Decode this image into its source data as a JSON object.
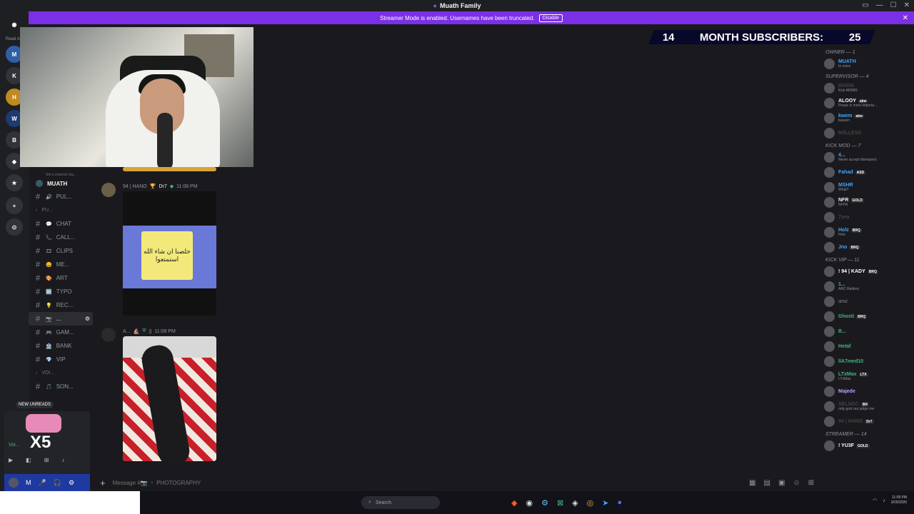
{
  "window": {
    "title": "Muath Family",
    "controls": [
      "▭",
      "—",
      "☐",
      "✕"
    ]
  },
  "banner": {
    "text": "Streamer Mode is enabled. Usernames have been truncated.",
    "button": "Disable",
    "close": "✕"
  },
  "left_rail": {
    "read_label": "Read A"
  },
  "sub_overlay": {
    "left_number": "14",
    "label": "MONTH SUBSCRIBERS:",
    "right_number": "25"
  },
  "server": {
    "name": "MUATH",
    "status_text": "Set a channel sta...",
    "channels": [
      {
        "icon": "🔊",
        "label": "PUL..."
      },
      {
        "icon": "",
        "label": "PU...",
        "category": true
      },
      {
        "icon": "💬",
        "label": "CHAT"
      },
      {
        "icon": "📞",
        "label": "CALL..."
      },
      {
        "icon": "🎞",
        "label": "CLIPS"
      },
      {
        "icon": "😄",
        "label": "ME..."
      },
      {
        "icon": "🎨",
        "label": "ART"
      },
      {
        "icon": "🔤",
        "label": "TYPO"
      },
      {
        "icon": "💡",
        "label": "REC..."
      },
      {
        "icon": "📷",
        "label": "...",
        "selected": true
      },
      {
        "icon": "🎮",
        "label": "GAM..."
      },
      {
        "icon": "🏦",
        "label": "BANK"
      },
      {
        "icon": "💎",
        "label": "VIP"
      },
      {
        "icon": "",
        "label": "VOI...",
        "category": true
      },
      {
        "icon": "🎵",
        "label": "SON..."
      }
    ],
    "new_unreads": "NEW UNREADS"
  },
  "messages": [
    {
      "author": "94 | HANO",
      "badge": "Dr7",
      "time": "11:08 PM",
      "image_text": "خلصنا ان شاء الله استمتعوا"
    },
    {
      "author": "A...",
      "time": "11:08 PM"
    }
  ],
  "composer": {
    "placeholder": "Message #📷 ・ PHOTOGRAPHY"
  },
  "members": {
    "groups": [
      {
        "title": "OWNER — 1",
        "items": [
          {
            "name": "MUATH",
            "sub": "In voice",
            "color": "#3ea6ff"
          }
        ]
      },
      {
        "title": "SUPERVISOR — 4",
        "items": [
          {
            "name": "BHSNI",
            "sub": "Kick ARM91",
            "color": "#444"
          },
          {
            "name": "ALOOY",
            "sub": "Peace is more importa...",
            "color": "#ffffff",
            "badge": "akw"
          },
          {
            "name": "kwem",
            "sub": "kweem",
            "color": "#3ea6ff",
            "badge": "akw"
          },
          {
            "name": "M3LLESS",
            "sub": "",
            "color": "#444"
          }
        ]
      },
      {
        "title": "KICK MOD — 7",
        "items": [
          {
            "name": "4...",
            "sub": "Never accept disrespect",
            "color": "#3ea6ff"
          },
          {
            "name": "Fahad",
            "sub": "",
            "color": "#3ea6ff",
            "badge": "ASD"
          },
          {
            "name": "MSHR",
            "sub": "What?",
            "color": "#3ea6ff"
          },
          {
            "name": "NFR",
            "sub": "NFFR",
            "color": "#f2f3f5",
            "badge": "GOLD"
          },
          {
            "name": "7yea",
            "sub": "",
            "color": "#444"
          },
          {
            "name": "Holz",
            "sub": "Holz",
            "color": "#3ea6ff",
            "badge": "BRQ"
          },
          {
            "name": "Jno",
            "sub": "",
            "color": "#3ea6ff",
            "badge": "BRQ"
          }
        ]
      },
      {
        "title": "KICK VIP — 11",
        "items": [
          {
            "name": "! 94 | KADY",
            "sub": "",
            "color": "#ffffff",
            "badge": "BRQ"
          },
          {
            "name": "1...",
            "sub": "ARC Raiders",
            "color": "#43b581"
          },
          {
            "name": "",
            "sub": "9DNZ",
            "color": "#43b581"
          },
          {
            "name": "Ghosti",
            "sub": "",
            "color": "#43b581",
            "badge": "BRQ"
          },
          {
            "name": "B...",
            "sub": "",
            "color": "#43b581"
          },
          {
            "name": "Hetaf",
            "sub": "",
            "color": "#43b581"
          },
          {
            "name": "llA7med10",
            "sub": "",
            "color": "#43b581"
          },
          {
            "name": "LTxMax",
            "sub": "LTxMax",
            "color": "#43b581",
            "badge": "LTX"
          },
          {
            "name": "Majede",
            "sub": "",
            "color": "#c39bff"
          },
          {
            "name": "SELSGC",
            "sub": "only god can judge me",
            "color": "#444",
            "badge": "BR"
          },
          {
            "name": "94 | HANO",
            "sub": "",
            "color": "#444",
            "badge": "Dr7"
          }
        ]
      },
      {
        "title": "STREAMER — 14",
        "items": [
          {
            "name": "! YU3F",
            "sub": "",
            "color": "#ffffff",
            "badge": "GOLD"
          }
        ]
      }
    ]
  },
  "user_panel": {
    "name": "M",
    "voice_label": "Voi...",
    "multiplier": "X5"
  },
  "taskbar": {
    "search": "Search",
    "time": "11:08 PM",
    "date": "3/25/2026"
  },
  "colors": {
    "accent": "#7b2fe6",
    "blue": "#3ea6ff",
    "green": "#43b581"
  }
}
